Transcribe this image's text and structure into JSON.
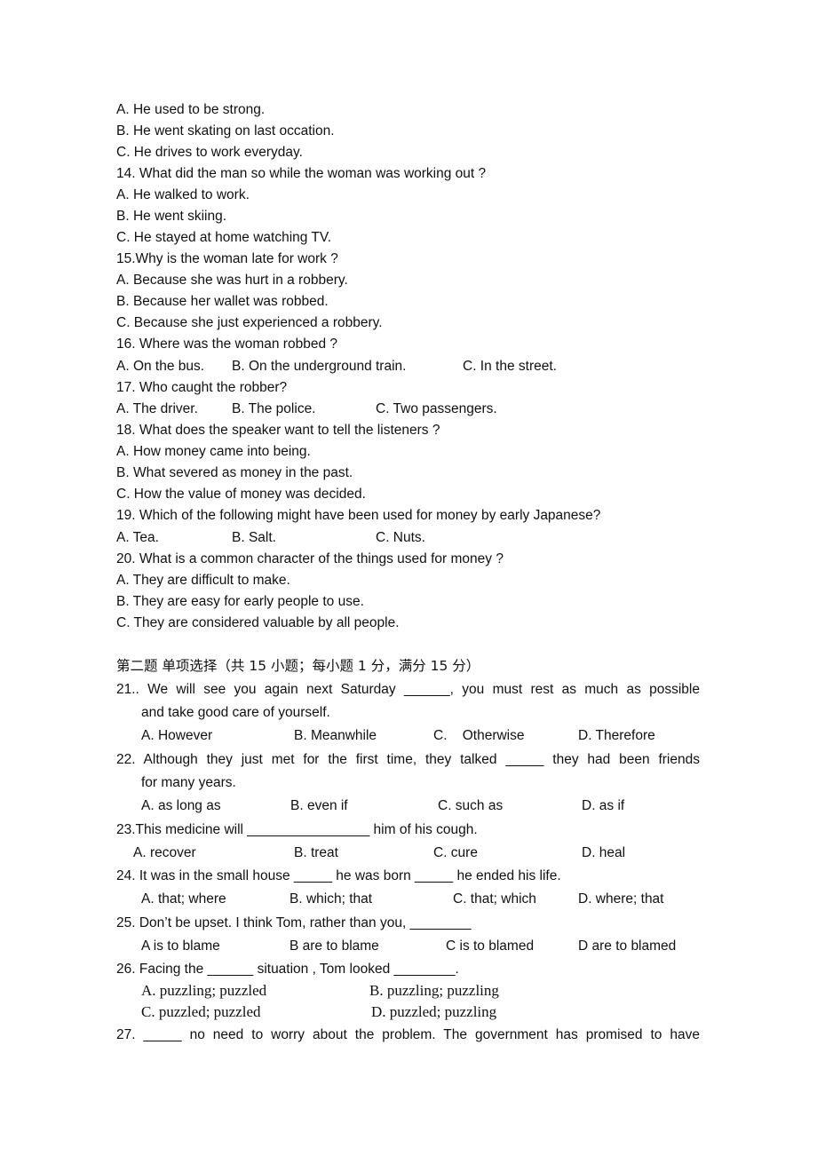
{
  "part1": {
    "q13_options": [
      "A. He used to be strong.",
      "B. He went skating on last occation.",
      "C. He drives to work everyday."
    ],
    "q14": {
      "question": "14. What did the man so while the woman was working out ?",
      "options": [
        "A. He walked to work.",
        "B. He went skiing.",
        "C. He stayed at home watching TV."
      ]
    },
    "q15": {
      "question": "15.Why is the woman late for work ?",
      "options": [
        "A. Because she was hurt in a robbery.",
        "B. Because her wallet was robbed.",
        "C. Because she just experienced a robbery."
      ]
    },
    "q16": {
      "question": "16. Where was the woman robbed ?",
      "options": [
        "A. On the bus.",
        "B. On the underground train.",
        "C. In the street."
      ]
    },
    "q17": {
      "question": "17. Who caught the robber?",
      "options": [
        "A. The driver.",
        "B. The police.",
        "C. Two passengers."
      ]
    },
    "q18": {
      "question": "18. What does the speaker want to tell the listeners ?",
      "options": [
        "A. How money came into being.",
        "B. What severed as money in the past.",
        "C. How the value of money was decided."
      ]
    },
    "q19": {
      "question": "19. Which of the following might have been used for money by early Japanese?",
      "options": [
        "A. Tea.",
        "B. Salt.",
        "C. Nuts."
      ]
    },
    "q20": {
      "question": "20. What is a common character of the things used for money ?",
      "options": [
        "A. They are difficult to make.",
        "B. They are easy for early people to use.",
        "C. They are considered valuable by all people."
      ]
    }
  },
  "part2": {
    "heading": "第二题  单项选择（共 15 小题；每小题 1 分，满分 15 分）",
    "q21": {
      "line1": "21.. We will see you again next Saturday ______, you must rest as much as possible",
      "line2": "and take good care of yourself.",
      "options": [
        "A. However",
        "B. Meanwhile",
        "C.    Otherwise",
        "D. Therefore"
      ]
    },
    "q22": {
      "line1": "22. Although they just met for the first time, they talked _____ they had been friends",
      "line2": "for many years.",
      "options": [
        "A. as long as",
        "B. even if",
        "C. such as",
        "D. as if"
      ]
    },
    "q23": {
      "line1": "23.This medicine will ________________ him of his cough.",
      "options": [
        "A. recover",
        "B. treat",
        "C. cure",
        "D. heal"
      ]
    },
    "q24": {
      "line1": "24. It was in the small house _____ he was born _____ he ended his life.",
      "options": [
        "A. that; where",
        "B. which; that",
        "C. that; which",
        "D. where; that"
      ]
    },
    "q25": {
      "line1": "25. Don’t be upset. I think Tom, rather than you, ________",
      "options": [
        "A is to blame",
        "B are to blame",
        "C is to blamed",
        "D are to blamed"
      ]
    },
    "q26": {
      "line1": "26. Facing the ______ situation , Tom looked ________.",
      "options": [
        "A. puzzling; puzzled",
        "B. puzzling; puzzling",
        "C. puzzled; puzzled",
        "D. puzzled; puzzling"
      ]
    },
    "q27": {
      "line1": "27. _____ no need to worry about the problem. The government has promised to have"
    }
  }
}
